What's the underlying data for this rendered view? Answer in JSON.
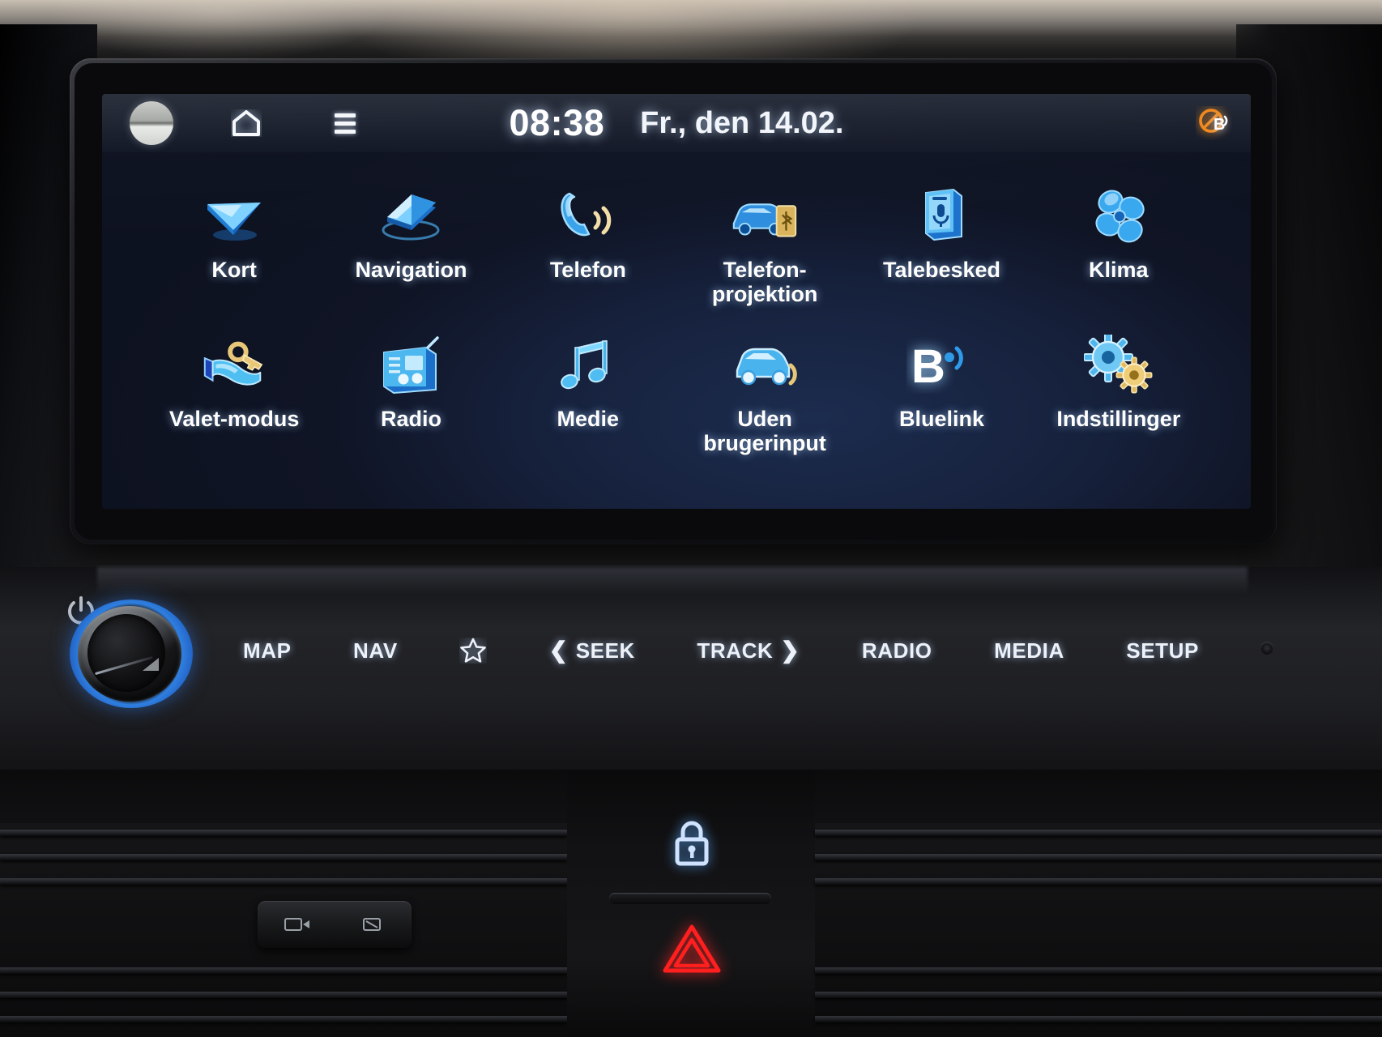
{
  "device": {
    "name": "Hyundai infotainment head unit",
    "screen_label": "home-menu"
  },
  "status_bar": {
    "profile_icon": "profile-avatar-icon",
    "home_icon": "home-icon",
    "menu_icon": "hamburger-menu-icon",
    "time": "08:38",
    "date": "Fr., den 14.02.",
    "connectivity_icon": "bluelink-disconnected-icon",
    "connectivity_state": "disconnected"
  },
  "colors": {
    "screen_bg_top": "#2c3038",
    "screen_bg_bottom": "#101728",
    "accent_blue": "#35a8f0",
    "icon_blue_light": "#9ddcff",
    "icon_blue_deep": "#1a6fd4",
    "icon_gold": "#e8c878",
    "hazard_red": "#ff1f1f",
    "knob_ring_blue": "#2f7fe0",
    "label_white": "#ffffff"
  },
  "app_grid": {
    "rows": 2,
    "columns": 6,
    "tiles": [
      {
        "id": "kort",
        "label": "Kort",
        "icon": "navigation-arrow-icon"
      },
      {
        "id": "navigation",
        "label": "Navigation",
        "icon": "folded-map-icon"
      },
      {
        "id": "telefon",
        "label": "Telefon",
        "icon": "phone-handset-icon"
      },
      {
        "id": "telefon-projektion",
        "label": "Telefon-\nprojektion",
        "icon": "car-phone-projection-icon"
      },
      {
        "id": "talebesked",
        "label": "Talebesked",
        "icon": "voice-memo-microphone-icon"
      },
      {
        "id": "klima",
        "label": "Klima",
        "icon": "climate-fan-icon"
      },
      {
        "id": "valet-modus",
        "label": "Valet-modus",
        "icon": "hand-key-icon"
      },
      {
        "id": "radio",
        "label": "Radio",
        "icon": "radio-receiver-icon"
      },
      {
        "id": "medie",
        "label": "Medie",
        "icon": "music-note-icon"
      },
      {
        "id": "uden-brugerinput",
        "label": "Uden\nbrugerinput",
        "icon": "car-assist-icon"
      },
      {
        "id": "bluelink",
        "label": "Bluelink",
        "icon": "bluelink-b-icon"
      },
      {
        "id": "indstillinger",
        "label": "Indstillinger",
        "icon": "settings-gears-icon"
      }
    ]
  },
  "hard_keys": {
    "power_icon": "power-icon",
    "volume_knob": "volume-power-knob",
    "buttons": [
      {
        "id": "map",
        "label": "MAP",
        "icon": null
      },
      {
        "id": "nav",
        "label": "NAV",
        "icon": null
      },
      {
        "id": "star",
        "label": "",
        "icon": "star-favorite-icon"
      },
      {
        "id": "seek",
        "label": "SEEK",
        "icon": "chevron-left-icon",
        "icon_position": "left"
      },
      {
        "id": "track",
        "label": "TRACK",
        "icon": "chevron-right-icon",
        "icon_position": "right"
      },
      {
        "id": "radio",
        "label": "RADIO",
        "icon": null
      },
      {
        "id": "media",
        "label": "MEDIA",
        "icon": null
      },
      {
        "id": "setup",
        "label": "SETUP",
        "icon": null
      }
    ],
    "reset_pinhole": "reset-pinhole"
  },
  "lower_console": {
    "lock_button_icon": "door-lock-icon",
    "hazard_button_icon": "hazard-warning-triangle-icon",
    "vent_left": "air-vent-left",
    "vent_right": "air-vent-right"
  }
}
